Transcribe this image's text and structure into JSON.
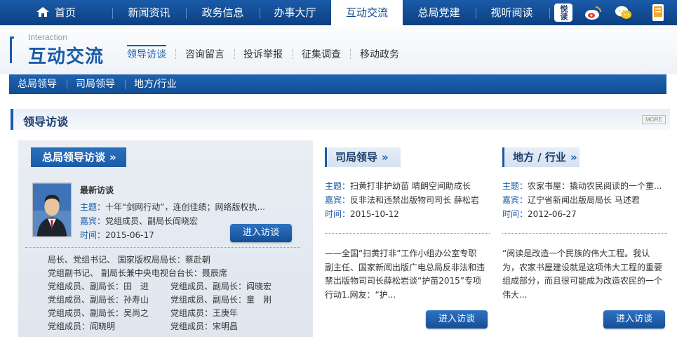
{
  "topnav": {
    "items": [
      "首页",
      "新闻资讯",
      "政务信息",
      "办事大厅",
      "互动交流",
      "总局党建",
      "视听阅读"
    ],
    "active": "互动交流",
    "icons": [
      "yuedu-icon",
      "weibo-icon",
      "wechat-icon",
      "mobile-icon"
    ],
    "yuedu_label": "悦读"
  },
  "section": {
    "en": "Interaction",
    "cn": "互动交流",
    "subnav": [
      "领导访谈",
      "咨询留言",
      "投诉举报",
      "征集调查",
      "移动政务"
    ],
    "active_subnav": "领导访谈"
  },
  "bluebar": {
    "items": [
      "总局领导",
      "司局领导",
      "地方/行业"
    ]
  },
  "content": {
    "title": "领导访谈",
    "more": "MORE",
    "left": {
      "tag": "总局领导访谈",
      "latest": "最新访谈",
      "topic_label": "主题：",
      "topic": "十年“剑网行动”，连创佳绩；网络版权执...",
      "guest_label": "嘉宾：",
      "guest": "党组成员、副局长阎晓宏",
      "time_label": "时间：",
      "time": "2015-06-17",
      "button": "进入访谈",
      "leaders": [
        "局长、党组书记、 国家版权局局长：蔡赴朝",
        "党组副书记、 副局长兼中央电视台台长：聂辰席",
        "党组成员、副局长：田　进",
        "党组成员、副局长：阎晓宏",
        "党组成员、副局长：孙寿山",
        "党组成员、副局长：童　刚",
        "党组成员、副局长：吴尚之",
        "党组成员：王庚年",
        "党组成员：阎晓明",
        "党组成员：宋明昌"
      ]
    },
    "mid": {
      "tag": "司局领导",
      "topic_label": "主题：",
      "topic": "扫黄打非护幼苗 晴朗空间助成长",
      "guest_label": "嘉宾：",
      "guest": "反非法和违禁出版物司司长 薛松岩",
      "time_label": "时间：",
      "time": "2015-10-12",
      "para": [
        "——全国“扫黄打非”工作小组办公室专职",
        "副主任、国家新闻出版广电总局反非法和违",
        "禁出版物司司长薛松岩谈“护苗2015”专项",
        "行动1.网友：“护..."
      ],
      "button": "进入访谈"
    },
    "right": {
      "tag": "地方 / 行业",
      "topic_label": "主题：",
      "topic": "农家书屋：撬动农民阅读的一个重...",
      "guest_label": "嘉宾：",
      "guest": "辽宁省新闻出版局局长 马述君",
      "time_label": "时间：",
      "time": "2012-06-27",
      "para": [
        "“阅读是改造一个民族的伟大工程。我认",
        "为，农家书屋建设就是这项伟大工程的重要",
        "组成部分，而且很可能成为改造农民的一个",
        "伟大..."
      ],
      "button": "进入访谈"
    }
  }
}
